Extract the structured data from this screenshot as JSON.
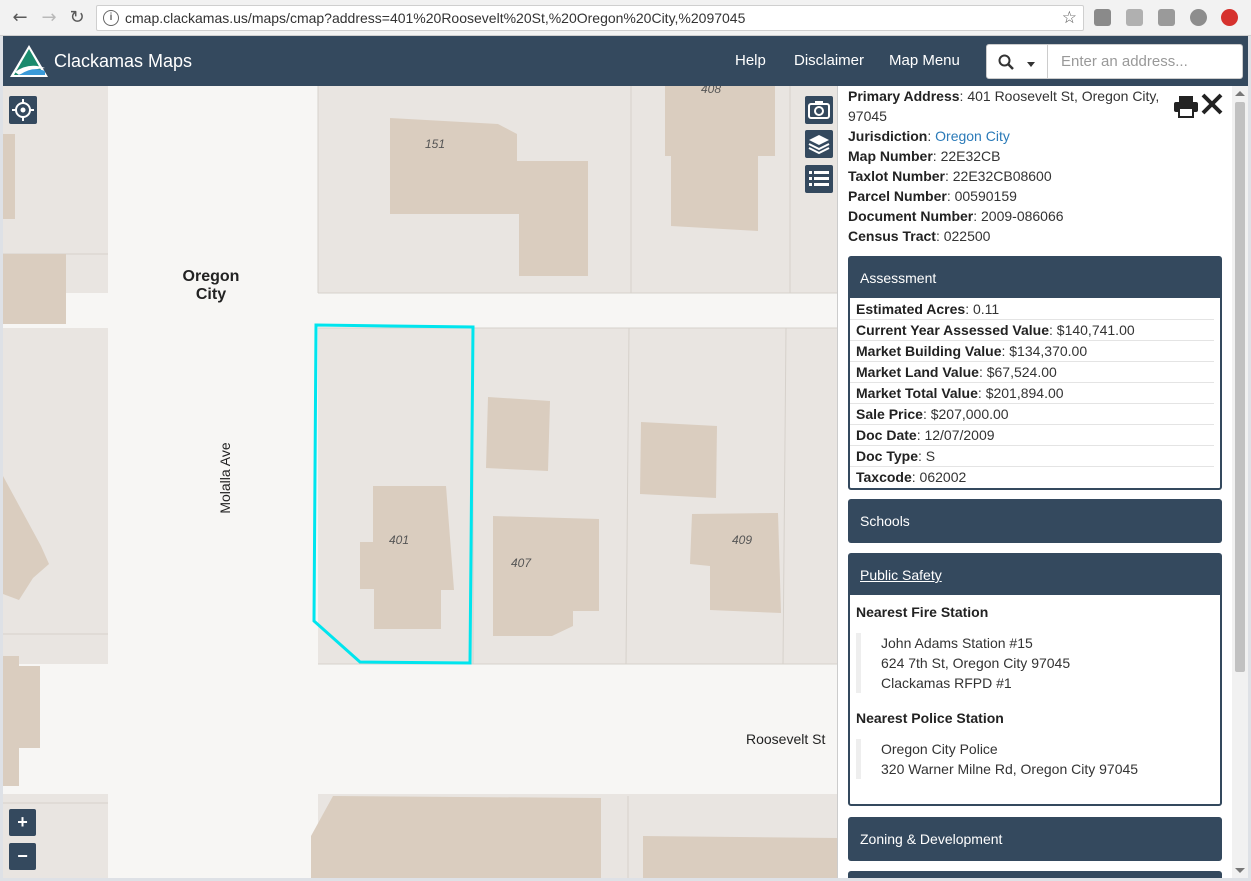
{
  "browser": {
    "url": "cmap.clackamas.us/maps/cmap?address=401%20Roosevelt%20St,%20Oregon%20City,%2097045",
    "info_glyph": "i"
  },
  "header": {
    "app_title": "Clackamas Maps",
    "nav": [
      "Help",
      "Disclaimer",
      "Map Menu"
    ],
    "search_placeholder": "Enter an address..."
  },
  "map": {
    "labels": {
      "city": "Oregon City",
      "street_vertical": "Molalla Ave",
      "street_horizontal": "Roosevelt St"
    },
    "building_numbers": [
      "408",
      "151",
      "401",
      "407",
      "409"
    ],
    "zoom_in": "+",
    "zoom_out": "−",
    "highlight_color": "#00e5ee"
  },
  "panel": {
    "primary_address_label": "Primary Address",
    "primary_address_line1": "401 Roosevelt St, Oregon City,",
    "primary_address_line2": "97045",
    "fields": [
      {
        "label": "Jurisdiction",
        "value": "Oregon City"
      },
      {
        "label": "Map Number",
        "value": "22E32CB"
      },
      {
        "label": "Taxlot Number",
        "value": "22E32CB08600"
      },
      {
        "label": "Parcel Number",
        "value": "00590159"
      },
      {
        "label": "Document Number",
        "value": "2009-086066"
      },
      {
        "label": "Census Tract",
        "value": "022500"
      }
    ],
    "assessment": {
      "title": "Assessment",
      "rows": [
        {
          "label": "Estimated Acres",
          "value": "0.11"
        },
        {
          "label": "Current Year Assessed Value",
          "value": "$140,741.00"
        },
        {
          "label": "Market Building Value",
          "value": "$134,370.00"
        },
        {
          "label": "Market Land Value",
          "value": "$67,524.00"
        },
        {
          "label": "Market Total Value",
          "value": "$201,894.00"
        },
        {
          "label": "Sale Price",
          "value": "$207,000.00"
        },
        {
          "label": "Doc Date",
          "value": "12/07/2009"
        },
        {
          "label": "Doc Type",
          "value": "S"
        },
        {
          "label": "Taxcode",
          "value": "062002"
        }
      ]
    },
    "schools_title": "Schools",
    "public_safety": {
      "title": "Public Safety",
      "fire_heading": "Nearest Fire Station",
      "fire_lines": [
        "John Adams Station #15",
        "624 7th St, Oregon City 97045",
        "Clackamas RFPD #1"
      ],
      "police_heading": "Nearest Police Station",
      "police_lines": [
        "Oregon City Police",
        "320 Warner Milne Rd, Oregon City 97045"
      ]
    },
    "zoning_title": "Zoning & Development"
  },
  "colors": {
    "header_bg": "#34495e",
    "link": "#2a7ab8",
    "map_bg": "#e9e5e1",
    "building": "#dacdbf",
    "road": "#f7f6f4"
  }
}
